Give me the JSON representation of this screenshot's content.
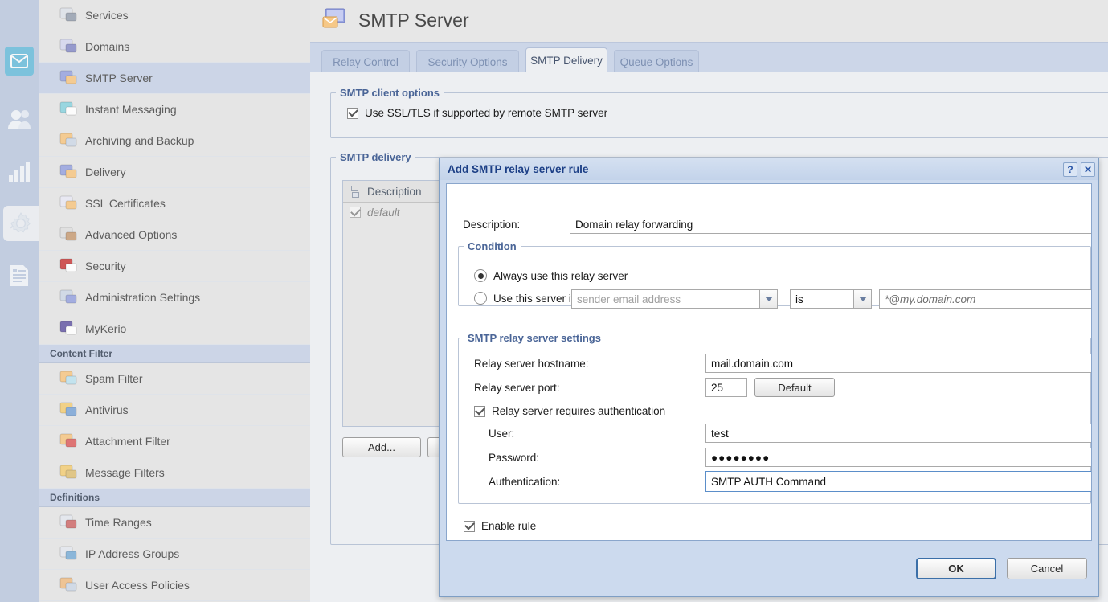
{
  "rail": {
    "items": [
      {
        "name": "mail-icon",
        "label": "Mail",
        "active": true
      },
      {
        "name": "users-icon",
        "label": "Accounts",
        "active": false
      },
      {
        "name": "chart-icon",
        "label": "Status",
        "active": false
      },
      {
        "name": "gear-icon",
        "label": "Configuration",
        "active": true
      },
      {
        "name": "log-icon",
        "label": "Logs",
        "active": false
      }
    ]
  },
  "sidebar": {
    "items": [
      {
        "label": "Services",
        "icon": "services-icon",
        "selected": false
      },
      {
        "label": "Domains",
        "icon": "at-icon",
        "selected": false
      },
      {
        "label": "SMTP Server",
        "icon": "smtp-server-icon",
        "selected": true
      },
      {
        "label": "Instant Messaging",
        "icon": "chat-icon",
        "selected": false
      },
      {
        "label": "Archiving and Backup",
        "icon": "archive-icon",
        "selected": false
      },
      {
        "label": "Delivery",
        "icon": "delivery-icon",
        "selected": false
      },
      {
        "label": "SSL Certificates",
        "icon": "certificate-icon",
        "selected": false
      },
      {
        "label": "Advanced Options",
        "icon": "advanced-options-icon",
        "selected": false
      },
      {
        "label": "Security",
        "icon": "security-icon",
        "selected": false
      },
      {
        "label": "Administration Settings",
        "icon": "administration-icon",
        "selected": false
      },
      {
        "label": "MyKerio",
        "icon": "mykerio-icon",
        "selected": false
      }
    ],
    "group_content_filter": "Content Filter",
    "content_filter_items": [
      {
        "label": "Spam Filter",
        "icon": "spam-filter-icon"
      },
      {
        "label": "Antivirus",
        "icon": "antivirus-icon"
      },
      {
        "label": "Attachment Filter",
        "icon": "attachment-filter-icon"
      },
      {
        "label": "Message Filters",
        "icon": "message-filters-icon"
      }
    ],
    "group_definitions": "Definitions",
    "definitions_items": [
      {
        "label": "Time Ranges",
        "icon": "time-ranges-icon"
      },
      {
        "label": "IP Address Groups",
        "icon": "ip-address-groups-icon"
      },
      {
        "label": "User Access Policies",
        "icon": "user-access-policies-icon"
      }
    ]
  },
  "header": {
    "title": "SMTP Server",
    "icon": "smtp-server-icon"
  },
  "tabs": [
    {
      "label": "Relay Control",
      "active": false
    },
    {
      "label": "Security Options",
      "active": false
    },
    {
      "label": "SMTP Delivery",
      "active": true
    },
    {
      "label": "Queue Options",
      "active": false
    }
  ],
  "client_options": {
    "legend": "SMTP client options",
    "ssl_label": "Use SSL/TLS if supported by remote SMTP server",
    "ssl_checked": true
  },
  "delivery": {
    "legend": "SMTP delivery",
    "column_header": "Description",
    "rows": [
      {
        "checked": true,
        "description": "default"
      }
    ],
    "add_button": "Add..."
  },
  "dialog": {
    "title": "Add SMTP relay server rule",
    "help_glyph": "?",
    "close_glyph": "✕",
    "description_label": "Description:",
    "description_value": "Domain relay forwarding",
    "condition": {
      "legend": "Condition",
      "always_label": "Always use this relay server",
      "always_selected": true,
      "conditional_label": "Use this server if",
      "conditional_selected": false,
      "field_placeholder": "sender email address",
      "operator_value": "is",
      "pattern_placeholder": "*@my.domain.com"
    },
    "relay": {
      "legend": "SMTP relay server settings",
      "hostname_label": "Relay server hostname:",
      "hostname_value": "mail.domain.com",
      "port_label": "Relay server port:",
      "port_value": "25",
      "default_button": "Default",
      "auth_required_label": "Relay server requires authentication",
      "auth_required_checked": true,
      "user_label": "User:",
      "user_value": "test",
      "password_label": "Password:",
      "password_value": "●●●●●●●●",
      "authentication_label": "Authentication:",
      "authentication_value": "SMTP AUTH Command"
    },
    "enable_rule_label": "Enable rule",
    "enable_rule_checked": true,
    "scroll_left_glyph": "‹",
    "scroll_right_glyph": "›",
    "ok_button": "OK",
    "cancel_button": "Cancel"
  },
  "colors": {
    "accent_blue": "#1c3f86",
    "legend_blue": "#4a6597",
    "rail_blue": "#b4c4de",
    "tabstrip_blue": "#ccd6e8",
    "selected_row": "#c9d3e7"
  }
}
